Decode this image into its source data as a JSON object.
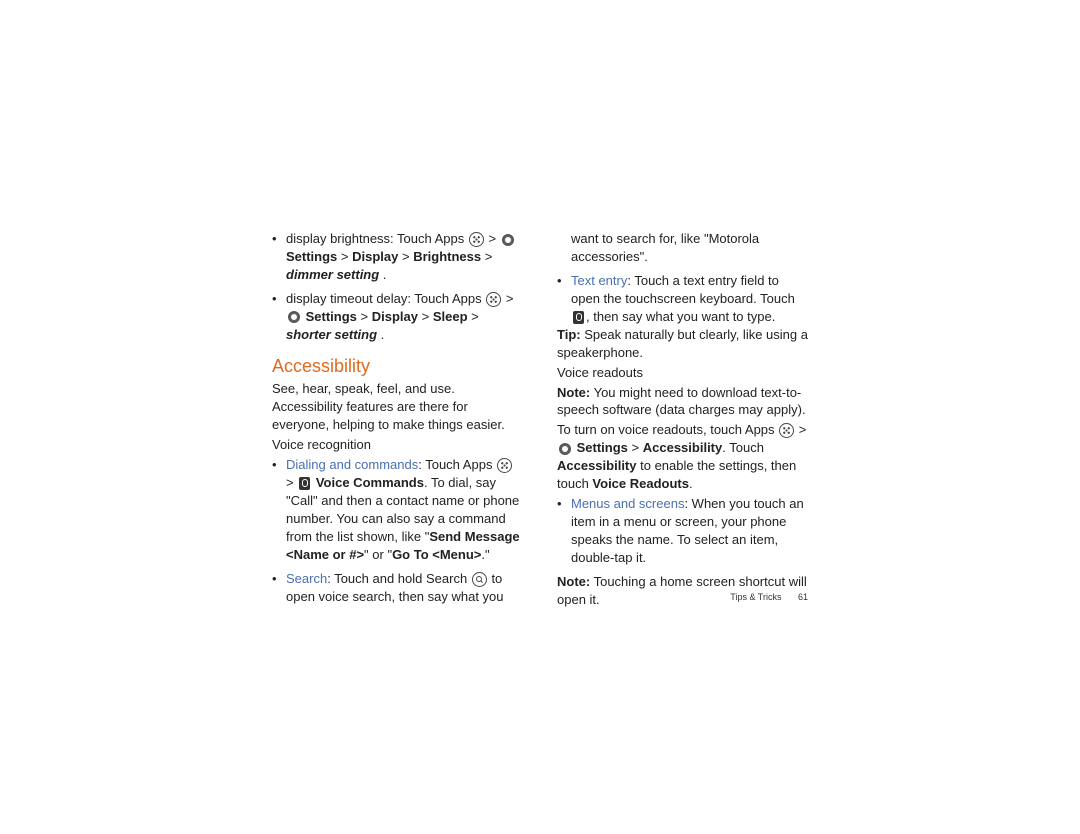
{
  "col1": {
    "brightness_pre": "display brightness: Touch Apps",
    "brightness_path_a": "Settings",
    "brightness_path_b": "Display",
    "brightness_path_c": "Brightness",
    "brightness_end": "dimmer setting",
    "timeout_pre": "display timeout delay: Touch Apps",
    "timeout_path_a": "Settings",
    "timeout_path_b": "Display",
    "timeout_path_c": "Sleep",
    "timeout_end": "shorter setting",
    "heading": "Accessibility",
    "intro": "See, hear, speak, feel, and use. Accessibility features are there for everyone, helping to make things easier.",
    "sub_voice_recog": "Voice recognition",
    "dial_label": "Dialing and commands",
    "dial_pre": ": Touch Apps",
    "dial_vc": "Voice Commands",
    "dial_post": ". To dial, say \"Call\" and then a contact name or phone number. You can also say a command from the list shown, like \"",
    "dial_cmd1": "Send Message <Name or #>",
    "dial_or": "\" or \"",
    "dial_cmd2": "Go To <Menu>",
    "dial_end": ".\"",
    "search_label": "Search",
    "search_pre": ": Touch and hold Search",
    "search_post": "to open voice search, then say what you"
  },
  "col2": {
    "cont": "want to search for, like \"Motorola accessories\".",
    "text_label": "Text entry",
    "text_pre": ": Touch a text entry field to open the touchscreen keyboard. Touch",
    "text_post": ", then say what you want to type.",
    "tip_b": "Tip:",
    "tip": " Speak naturally but clearly, like using a speakerphone.",
    "sub_voice_read": "Voice readouts",
    "note1_b": "Note:",
    "note1": " You might need to download text-to-speech software (data charges may apply).",
    "turnon_pre": "To turn on voice readouts, touch Apps",
    "turnon_set": "Settings",
    "turnon_acc": "Accessibility",
    "turnon_post1": ". Touch ",
    "turnon_acc2": "Accessibility",
    "turnon_post2": " to enable the settings, then touch ",
    "turnon_vr": "Voice Readouts",
    "menus_label": "Menus and screens",
    "menus_post": ": When you touch an item in a menu or screen, your phone speaks the name. To select an item, double-tap it.",
    "note2_b": "Note:",
    "note2": " Touching a home screen shortcut will open it."
  },
  "footer": {
    "section": "Tips & Tricks",
    "page": "61"
  }
}
